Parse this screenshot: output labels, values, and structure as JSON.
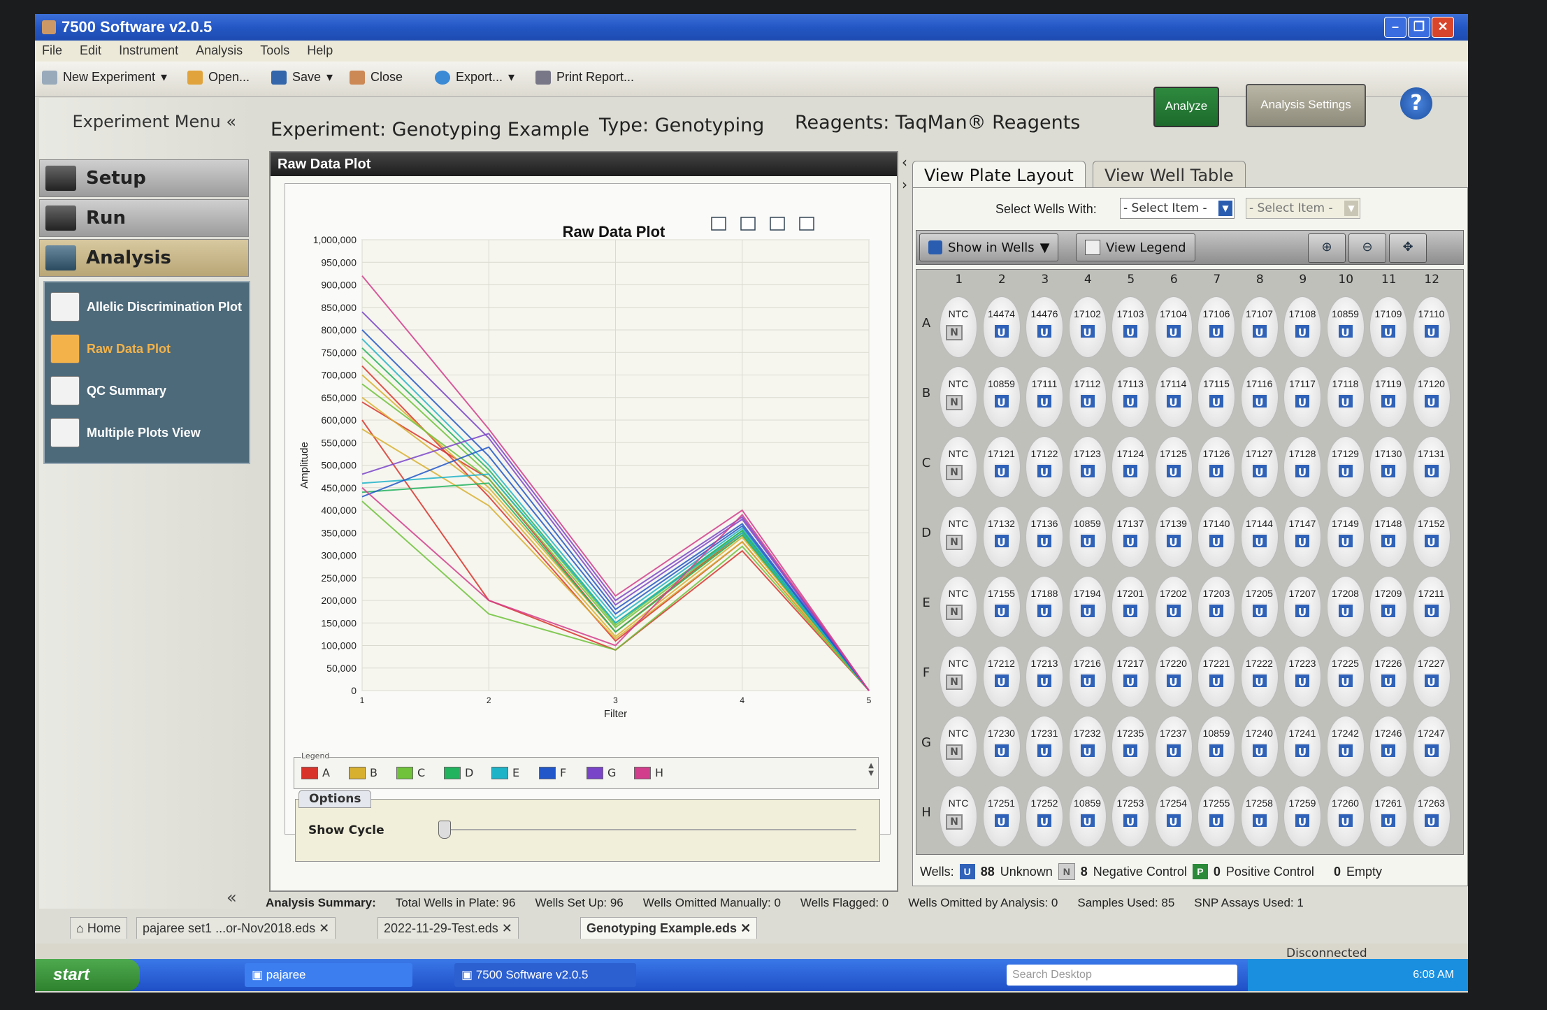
{
  "window": {
    "title": "7500 Software v2.0.5"
  },
  "menu": [
    "File",
    "Edit",
    "Instrument",
    "Analysis",
    "Tools",
    "Help"
  ],
  "toolbar": {
    "new_experiment": "New Experiment",
    "open": "Open...",
    "save": "Save",
    "close": "Close",
    "export": "Export...",
    "print_report": "Print Report..."
  },
  "left": {
    "menu_title": "Experiment Menu",
    "setup": "Setup",
    "run": "Run",
    "analysis": "Analysis",
    "sub": [
      "Allelic Discrimination Plot",
      "Raw Data Plot",
      "QC Summary",
      "Multiple Plots View"
    ]
  },
  "header": {
    "experiment": "Experiment:  Genotyping Example",
    "type": "Type:  Genotyping",
    "reagents": "Reagents:  TaqMan® Reagents",
    "analyze": "Analyze",
    "analysis_settings": "Analysis Settings",
    "help": "?"
  },
  "plot_panel": {
    "header": "Raw Data Plot",
    "legend_title": "Legend",
    "options": "Options",
    "show_cycle": "Show Cycle"
  },
  "chart_data": {
    "type": "line",
    "title": "Raw Data Plot",
    "xlabel": "Filter",
    "ylabel": "Amplitude",
    "x": [
      1,
      2,
      3,
      4,
      5
    ],
    "ylim": [
      0,
      1000000
    ],
    "yticks": [
      "0",
      "50,000",
      "100,000",
      "150,000",
      "200,000",
      "250,000",
      "300,000",
      "350,000",
      "400,000",
      "450,000",
      "500,000",
      "550,000",
      "600,000",
      "650,000",
      "700,000",
      "750,000",
      "800,000",
      "850,000",
      "900,000",
      "950,000",
      "1,000,000"
    ],
    "xticks": [
      "1",
      "2",
      "3",
      "4",
      "5"
    ],
    "grid": true,
    "legend": [
      "A",
      "B",
      "C",
      "D",
      "E",
      "F",
      "G",
      "H"
    ],
    "series": [
      {
        "name": "A",
        "color": "#d9342b",
        "values": [
          720000,
          430000,
          110000,
          330000,
          0
        ]
      },
      {
        "name": "A",
        "color": "#d9342b",
        "values": [
          600000,
          200000,
          90000,
          310000,
          0
        ]
      },
      {
        "name": "A",
        "color": "#d9342b",
        "values": [
          640000,
          470000,
          130000,
          350000,
          0
        ]
      },
      {
        "name": "B",
        "color": "#d8b030",
        "values": [
          650000,
          440000,
          120000,
          340000,
          0
        ]
      },
      {
        "name": "B",
        "color": "#d8b030",
        "values": [
          700000,
          450000,
          130000,
          345000,
          0
        ]
      },
      {
        "name": "B",
        "color": "#d8b030",
        "values": [
          580000,
          410000,
          115000,
          330000,
          0
        ]
      },
      {
        "name": "C",
        "color": "#6fc23a",
        "values": [
          680000,
          470000,
          140000,
          350000,
          0
        ]
      },
      {
        "name": "C",
        "color": "#6fc23a",
        "values": [
          420000,
          170000,
          90000,
          320000,
          0
        ]
      },
      {
        "name": "C",
        "color": "#6fc23a",
        "values": [
          740000,
          480000,
          145000,
          355000,
          0
        ]
      },
      {
        "name": "D",
        "color": "#22b35e",
        "values": [
          760000,
          490000,
          150000,
          355000,
          0
        ]
      },
      {
        "name": "D",
        "color": "#22b35e",
        "values": [
          440000,
          460000,
          130000,
          345000,
          0
        ]
      },
      {
        "name": "E",
        "color": "#1fb3c8",
        "values": [
          780000,
          500000,
          160000,
          360000,
          0
        ]
      },
      {
        "name": "E",
        "color": "#1fb3c8",
        "values": [
          460000,
          480000,
          150000,
          350000,
          0
        ]
      },
      {
        "name": "F",
        "color": "#2157c9",
        "values": [
          800000,
          520000,
          170000,
          365000,
          0
        ]
      },
      {
        "name": "F",
        "color": "#2157c9",
        "values": [
          430000,
          540000,
          180000,
          370000,
          0
        ]
      },
      {
        "name": "G",
        "color": "#7a44c9",
        "values": [
          840000,
          560000,
          190000,
          380000,
          0
        ]
      },
      {
        "name": "G",
        "color": "#7a44c9",
        "values": [
          480000,
          570000,
          200000,
          385000,
          0
        ]
      },
      {
        "name": "H",
        "color": "#d23d8c",
        "values": [
          920000,
          580000,
          210000,
          400000,
          0
        ]
      },
      {
        "name": "H",
        "color": "#d23d8c",
        "values": [
          450000,
          200000,
          100000,
          390000,
          0
        ]
      }
    ]
  },
  "plate_panel": {
    "tab_layout": "View Plate Layout",
    "tab_table": "View Well Table",
    "select_wells_with": "Select Wells With:",
    "select_item_1": "- Select Item -",
    "select_item_2": "- Select Item -",
    "show_in_wells": "Show in Wells",
    "view_legend": "View Legend",
    "columns": [
      "1",
      "2",
      "3",
      "4",
      "5",
      "6",
      "7",
      "8",
      "9",
      "10",
      "11",
      "12"
    ],
    "rows": [
      "A",
      "B",
      "C",
      "D",
      "E",
      "F",
      "G",
      "H"
    ],
    "wells": [
      [
        "NTC",
        "14474",
        "14476",
        "17102",
        "17103",
        "17104",
        "17106",
        "17107",
        "17108",
        "10859",
        "17109",
        "17110"
      ],
      [
        "NTC",
        "10859",
        "17111",
        "17112",
        "17113",
        "17114",
        "17115",
        "17116",
        "17117",
        "17118",
        "17119",
        "17120"
      ],
      [
        "NTC",
        "17121",
        "17122",
        "17123",
        "17124",
        "17125",
        "17126",
        "17127",
        "17128",
        "17129",
        "17130",
        "17131"
      ],
      [
        "NTC",
        "17132",
        "17136",
        "10859",
        "17137",
        "17139",
        "17140",
        "17144",
        "17147",
        "17149",
        "17148",
        "17152"
      ],
      [
        "NTC",
        "17155",
        "17188",
        "17194",
        "17201",
        "17202",
        "17203",
        "17205",
        "17207",
        "17208",
        "17209",
        "17211"
      ],
      [
        "NTC",
        "17212",
        "17213",
        "17216",
        "17217",
        "17220",
        "17221",
        "17222",
        "17223",
        "17225",
        "17226",
        "17227"
      ],
      [
        "NTC",
        "17230",
        "17231",
        "17232",
        "17235",
        "17237",
        "10859",
        "17240",
        "17241",
        "17242",
        "17246",
        "17247"
      ],
      [
        "NTC",
        "17251",
        "17252",
        "10859",
        "17253",
        "17254",
        "17255",
        "17258",
        "17259",
        "17260",
        "17261",
        "17263"
      ]
    ],
    "wells_label": "Wells:",
    "unknown_count": "88",
    "unknown_label": "Unknown",
    "neg_count": "8",
    "neg_label": "Negative Control",
    "pos_count": "0",
    "pos_label": "Positive Control",
    "empty_count": "0",
    "empty_label": "Empty"
  },
  "summary": {
    "title": "Analysis Summary:",
    "total": "Total Wells in Plate: 96",
    "setup": "Wells Set Up: 96",
    "omitted_manual": "Wells Omitted Manually: 0",
    "flagged": "Wells Flagged: 0",
    "omitted_analysis": "Wells Omitted by Analysis: 0",
    "samples": "Samples Used: 85",
    "snp": "SNP Assays Used: 1"
  },
  "doc_tabs": [
    "Home",
    "pajaree set1 ...or-Nov2018.eds",
    "2022-11-29-Test.eds",
    "Genotyping Example.eds"
  ],
  "status": {
    "connection": "Disconnected"
  },
  "taskbar": {
    "start": "start",
    "task1": "pajaree",
    "task2": "7500 Software v2.0.5",
    "search": "Search Desktop",
    "clock": "6:08 AM"
  }
}
